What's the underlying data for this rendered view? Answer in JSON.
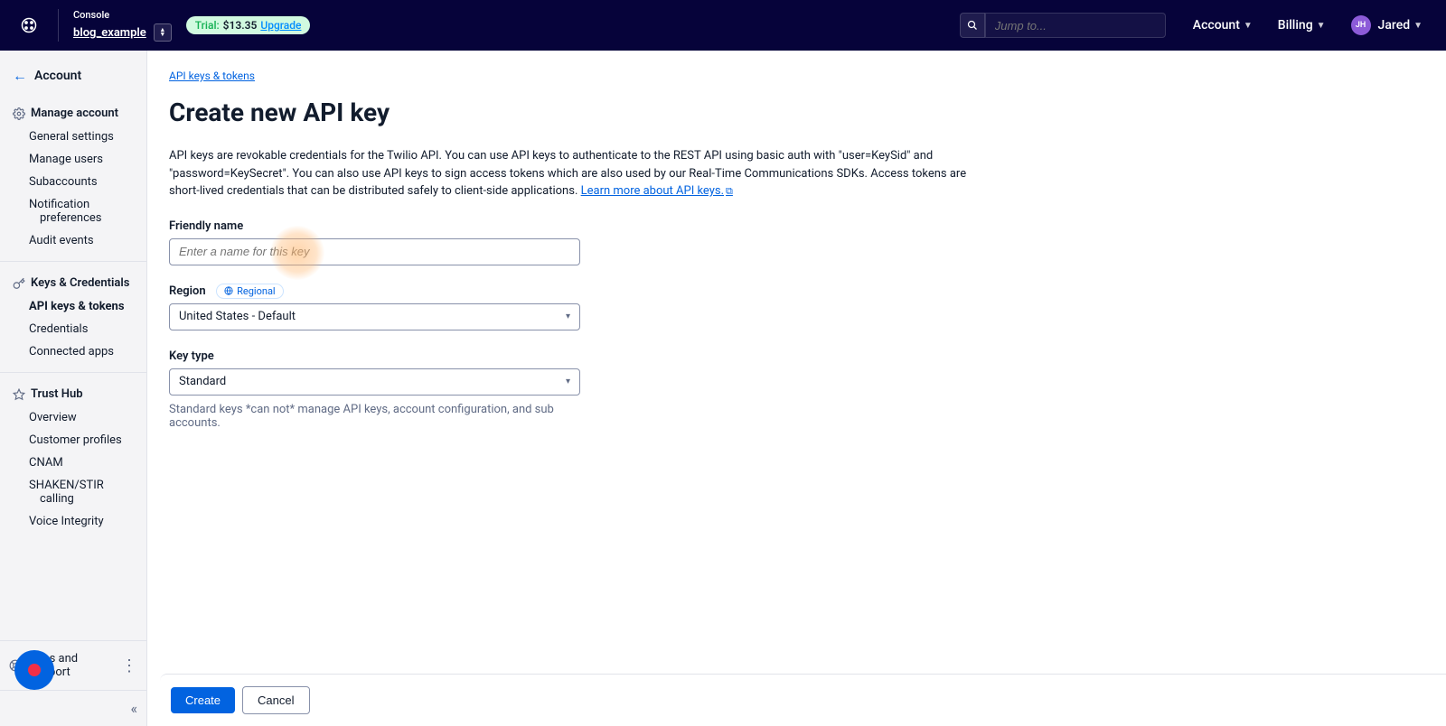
{
  "header": {
    "console_label": "Console",
    "project_name": "blog_example",
    "trial_prefix": "Trial:",
    "trial_amount": "$13.35",
    "upgrade": "Upgrade",
    "search_placeholder": "Jump to...",
    "menu_account": "Account",
    "menu_billing": "Billing",
    "avatar_initials": "JH",
    "user_name": "Jared"
  },
  "sidebar": {
    "back_label": "Account",
    "sections": {
      "manage": {
        "title": "Manage account",
        "items": [
          "General settings",
          "Manage users",
          "Subaccounts",
          "Notification preferences",
          "Audit events"
        ]
      },
      "keys": {
        "title": "Keys & Credentials",
        "items": [
          "API keys & tokens",
          "Credentials",
          "Connected apps"
        ]
      },
      "trust": {
        "title": "Trust Hub",
        "items": [
          "Overview",
          "Customer profiles",
          "CNAM",
          "SHAKEN/STIR calling",
          "Voice Integrity"
        ]
      }
    },
    "docs_support": "Docs and Support"
  },
  "main": {
    "breadcrumb": "API keys & tokens",
    "title": "Create new API key",
    "intro": "API keys are revokable credentials for the Twilio API. You can use API keys to authenticate to the REST API using basic auth with \"user=KeySid\" and \"password=KeySecret\". You can also use API keys to sign access tokens which are also used by our Real-Time Communications SDKs. Access tokens are short-lived credentials that can be distributed safely to client-side applications. ",
    "learn_more": "Learn more about API keys.",
    "friendly_name_label": "Friendly name",
    "friendly_name_placeholder": "Enter a name for this key",
    "region_label": "Region",
    "regional_badge": "Regional",
    "region_value": "United States - Default",
    "key_type_label": "Key type",
    "key_type_value": "Standard",
    "key_type_hint": "Standard keys *can not* manage API keys, account configuration, and sub accounts.",
    "btn_create": "Create",
    "btn_cancel": "Cancel"
  }
}
